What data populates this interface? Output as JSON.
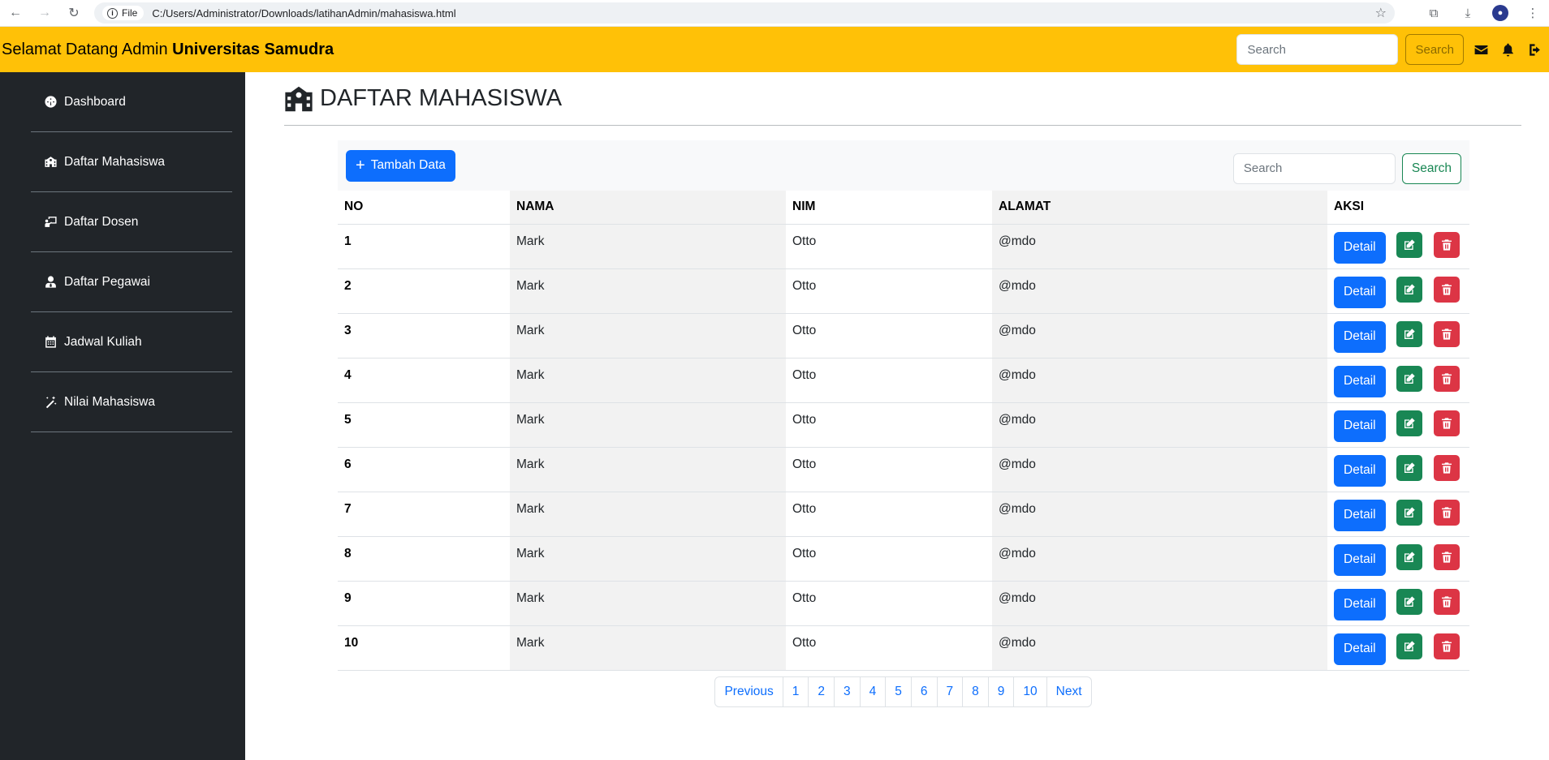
{
  "browser": {
    "file_label": "File",
    "url": "C:/Users/Administrator/Downloads/latihanAdmin/mahasiswa.html"
  },
  "navbar": {
    "brand_prefix": "Selamat Datang Admin",
    "brand_bold": "Universitas Samudra",
    "search_placeholder": "Search",
    "search_button": "Search",
    "bg_color": "#ffc107"
  },
  "sidebar": {
    "items": [
      {
        "label": "Dashboard",
        "icon": "gauge-icon"
      },
      {
        "label": "Daftar Mahasiswa",
        "icon": "school-icon"
      },
      {
        "label": "Daftar Dosen",
        "icon": "chalkboard-teacher-icon"
      },
      {
        "label": "Daftar Pegawai",
        "icon": "user-tie-icon"
      },
      {
        "label": "Jadwal Kuliah",
        "icon": "calendar-icon"
      },
      {
        "label": "Nilai Mahasiswa",
        "icon": "wand-icon"
      }
    ]
  },
  "page": {
    "title": "DAFTAR MAHASISWA",
    "add_button": "Tambah Data",
    "search_placeholder": "Search",
    "search_button": "Search"
  },
  "table": {
    "headers": [
      "NO",
      "NAMA",
      "NIM",
      "ALAMAT",
      "AKSI"
    ],
    "detail_label": "Detail",
    "rows": [
      {
        "no": "1",
        "nama": "Mark",
        "nim": "Otto",
        "alamat": "@mdo"
      },
      {
        "no": "2",
        "nama": "Mark",
        "nim": "Otto",
        "alamat": "@mdo"
      },
      {
        "no": "3",
        "nama": "Mark",
        "nim": "Otto",
        "alamat": "@mdo"
      },
      {
        "no": "4",
        "nama": "Mark",
        "nim": "Otto",
        "alamat": "@mdo"
      },
      {
        "no": "5",
        "nama": "Mark",
        "nim": "Otto",
        "alamat": "@mdo"
      },
      {
        "no": "6",
        "nama": "Mark",
        "nim": "Otto",
        "alamat": "@mdo"
      },
      {
        "no": "7",
        "nama": "Mark",
        "nim": "Otto",
        "alamat": "@mdo"
      },
      {
        "no": "8",
        "nama": "Mark",
        "nim": "Otto",
        "alamat": "@mdo"
      },
      {
        "no": "9",
        "nama": "Mark",
        "nim": "Otto",
        "alamat": "@mdo"
      },
      {
        "no": "10",
        "nama": "Mark",
        "nim": "Otto",
        "alamat": "@mdo"
      }
    ]
  },
  "pagination": {
    "previous": "Previous",
    "pages": [
      "1",
      "2",
      "3",
      "4",
      "5",
      "6",
      "7",
      "8",
      "9",
      "10"
    ],
    "next": "Next"
  }
}
